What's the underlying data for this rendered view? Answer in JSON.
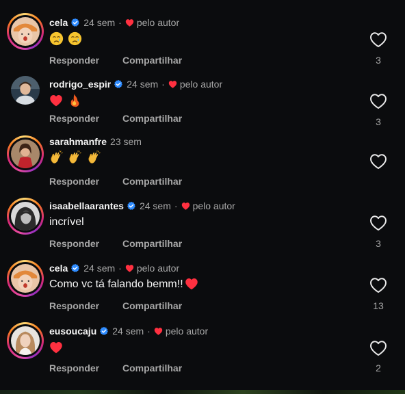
{
  "actions": {
    "reply_label": "Responder",
    "share_label": "Compartilhar"
  },
  "comments": [
    {
      "username": "cela",
      "verified": true,
      "time": "24 sem",
      "separator": "·",
      "liked_by_author": "pelo autor",
      "text": "",
      "emojis": [
        "crying-face",
        "crying-face"
      ],
      "likes": "3",
      "avatar_ring": true
    },
    {
      "username": "rodrigo_espir",
      "verified": true,
      "time": "24 sem",
      "separator": "·",
      "liked_by_author": "pelo autor",
      "text": "",
      "emojis": [
        "red-heart",
        "fire"
      ],
      "likes": "3",
      "avatar_ring": false
    },
    {
      "username": "sarahmanfre",
      "verified": false,
      "time": "23 sem",
      "text": "",
      "emojis": [
        "clapping-hands",
        "clapping-hands",
        "clapping-hands"
      ],
      "likes": "",
      "avatar_ring": true
    },
    {
      "username": "isaabellaarantes",
      "verified": true,
      "time": "24 sem",
      "separator": "·",
      "liked_by_author": "pelo autor",
      "text": "incrível",
      "emojis": [],
      "likes": "3",
      "avatar_ring": true
    },
    {
      "username": "cela",
      "verified": true,
      "time": "24 sem",
      "separator": "·",
      "liked_by_author": "pelo autor",
      "text": "Como vc tá falando bemm!!",
      "emojis": [
        "red-heart"
      ],
      "likes": "13",
      "avatar_ring": true
    },
    {
      "username": "eusoucaju",
      "verified": true,
      "time": "24 sem",
      "separator": "·",
      "liked_by_author": "pelo autor",
      "text": "",
      "emojis": [
        "red-heart"
      ],
      "likes": "2",
      "avatar_ring": true
    }
  ],
  "colors": {
    "background": "#0b0c0e",
    "verified_blue": "#2f8cff",
    "heart_red": "#ff3040",
    "muted_text": "#a8a8a8"
  },
  "icons": {
    "verified": "verified-badge-icon",
    "author_like": "heart-icon",
    "like_button": "heart-outline-icon"
  }
}
